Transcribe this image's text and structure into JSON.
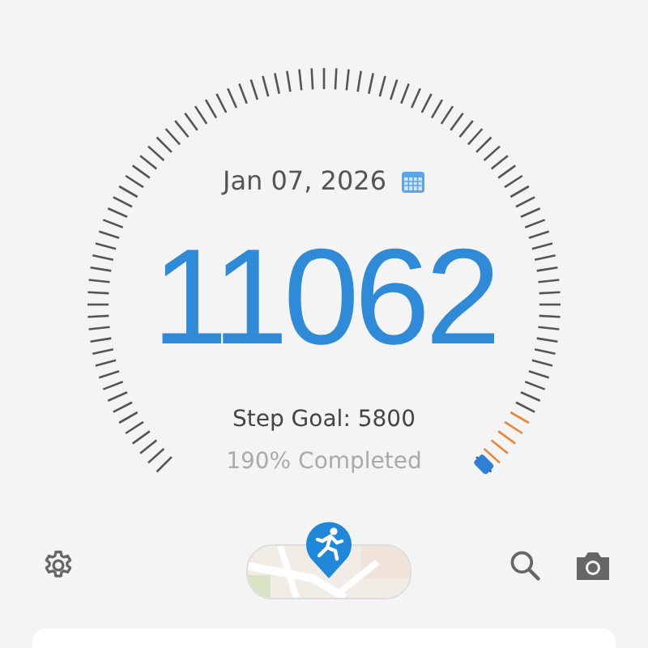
{
  "date": "Jan 07, 2026",
  "steps": "11062",
  "goal": "Step Goal: 5800",
  "completed": "190% Completed",
  "toolbar": [
    {
      "kind": "settings"
    },
    {
      "kind": "map"
    },
    {
      "kind": "search"
    },
    {
      "kind": "camera"
    }
  ]
}
